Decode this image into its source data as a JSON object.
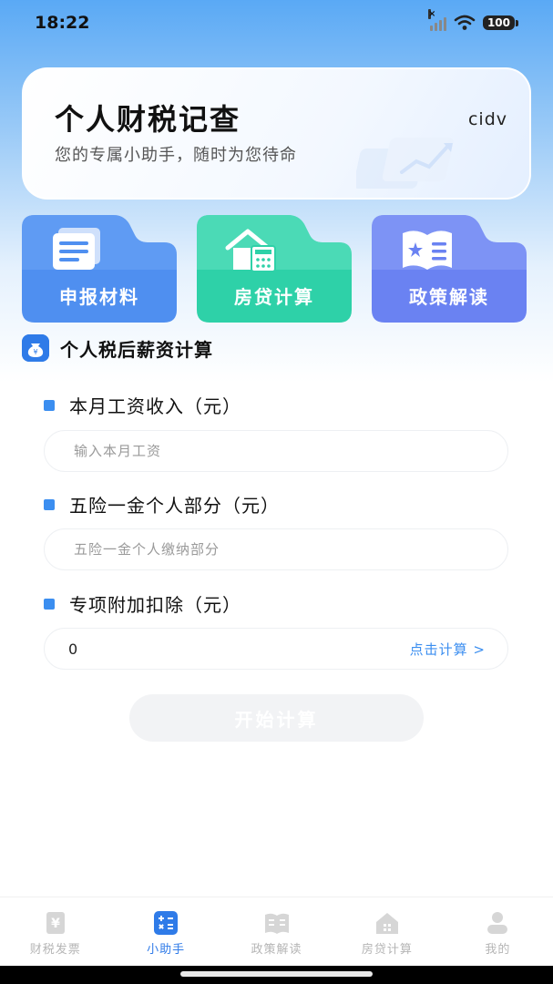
{
  "status_bar": {
    "time": "18:22",
    "battery": "100"
  },
  "hero": {
    "title": "个人财税记查",
    "subtitle": "您的专属小助手，随时为您待命",
    "username": "cidv"
  },
  "categories": [
    {
      "label": "申报材料",
      "icon": "documents-icon",
      "color": "#4f8ff0"
    },
    {
      "label": "房贷计算",
      "icon": "house-calculator-icon",
      "color": "#2ed1a8"
    },
    {
      "label": "政策解读",
      "icon": "policy-book-icon",
      "color": "#6a82f2"
    }
  ],
  "section": {
    "title": "个人税后薪资计算"
  },
  "form": {
    "salary_label": "本月工资收入（元）",
    "salary_placeholder": "输入本月工资",
    "insurance_label": "五险一金个人部分（元）",
    "insurance_placeholder": "五险一金个人缴纳部分",
    "deduction_label": "专项附加扣除（元）",
    "deduction_value": "0",
    "deduction_link": "点击计算 >",
    "start_button": "开始计算"
  },
  "tabbar": [
    {
      "label": "财税发票",
      "icon": "invoice-icon",
      "active": false
    },
    {
      "label": "小助手",
      "icon": "calculator-icon",
      "active": true
    },
    {
      "label": "政策解读",
      "icon": "book-icon",
      "active": false
    },
    {
      "label": "房贷计算",
      "icon": "house-icon",
      "active": false
    },
    {
      "label": "我的",
      "icon": "profile-icon",
      "active": false
    }
  ],
  "colors": {
    "primary": "#2f7be8",
    "accent": "#3b8ef0",
    "inactive": "#b5b5b5"
  }
}
